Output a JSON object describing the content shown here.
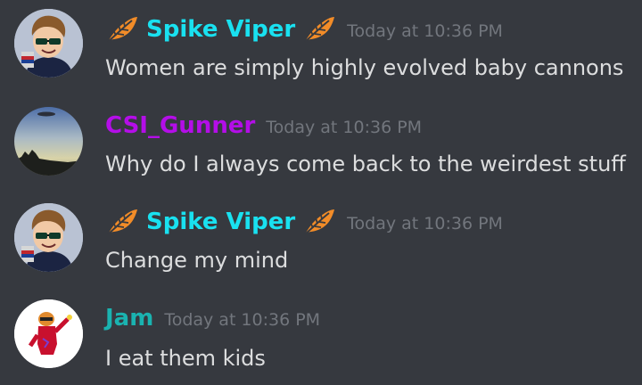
{
  "colors": {
    "background": "#36393f",
    "timestamp": "#72767d",
    "message_text": "#dcddde",
    "badge": "#f28c28"
  },
  "messages": [
    {
      "author": "Spike Viper",
      "author_color": "#19e1f0",
      "badge_icon": "leaf-icon",
      "timestamp": "Today at 10:36 PM",
      "content": "Women are simply highly evolved baby cannons"
    },
    {
      "author": "CSI_Gunner",
      "author_color": "#b40ee8",
      "timestamp": "Today at 10:36 PM",
      "content": "Why do I always come back to the weirdest stuff"
    },
    {
      "author": "Spike Viper",
      "author_color": "#19e1f0",
      "badge_icon": "leaf-icon",
      "timestamp": "Today at 10:36 PM",
      "content": "Change my mind"
    },
    {
      "author": "Jam",
      "author_color": "#1ab3b0",
      "timestamp": "Today at 10:36 PM",
      "content": "I eat them kids"
    }
  ]
}
